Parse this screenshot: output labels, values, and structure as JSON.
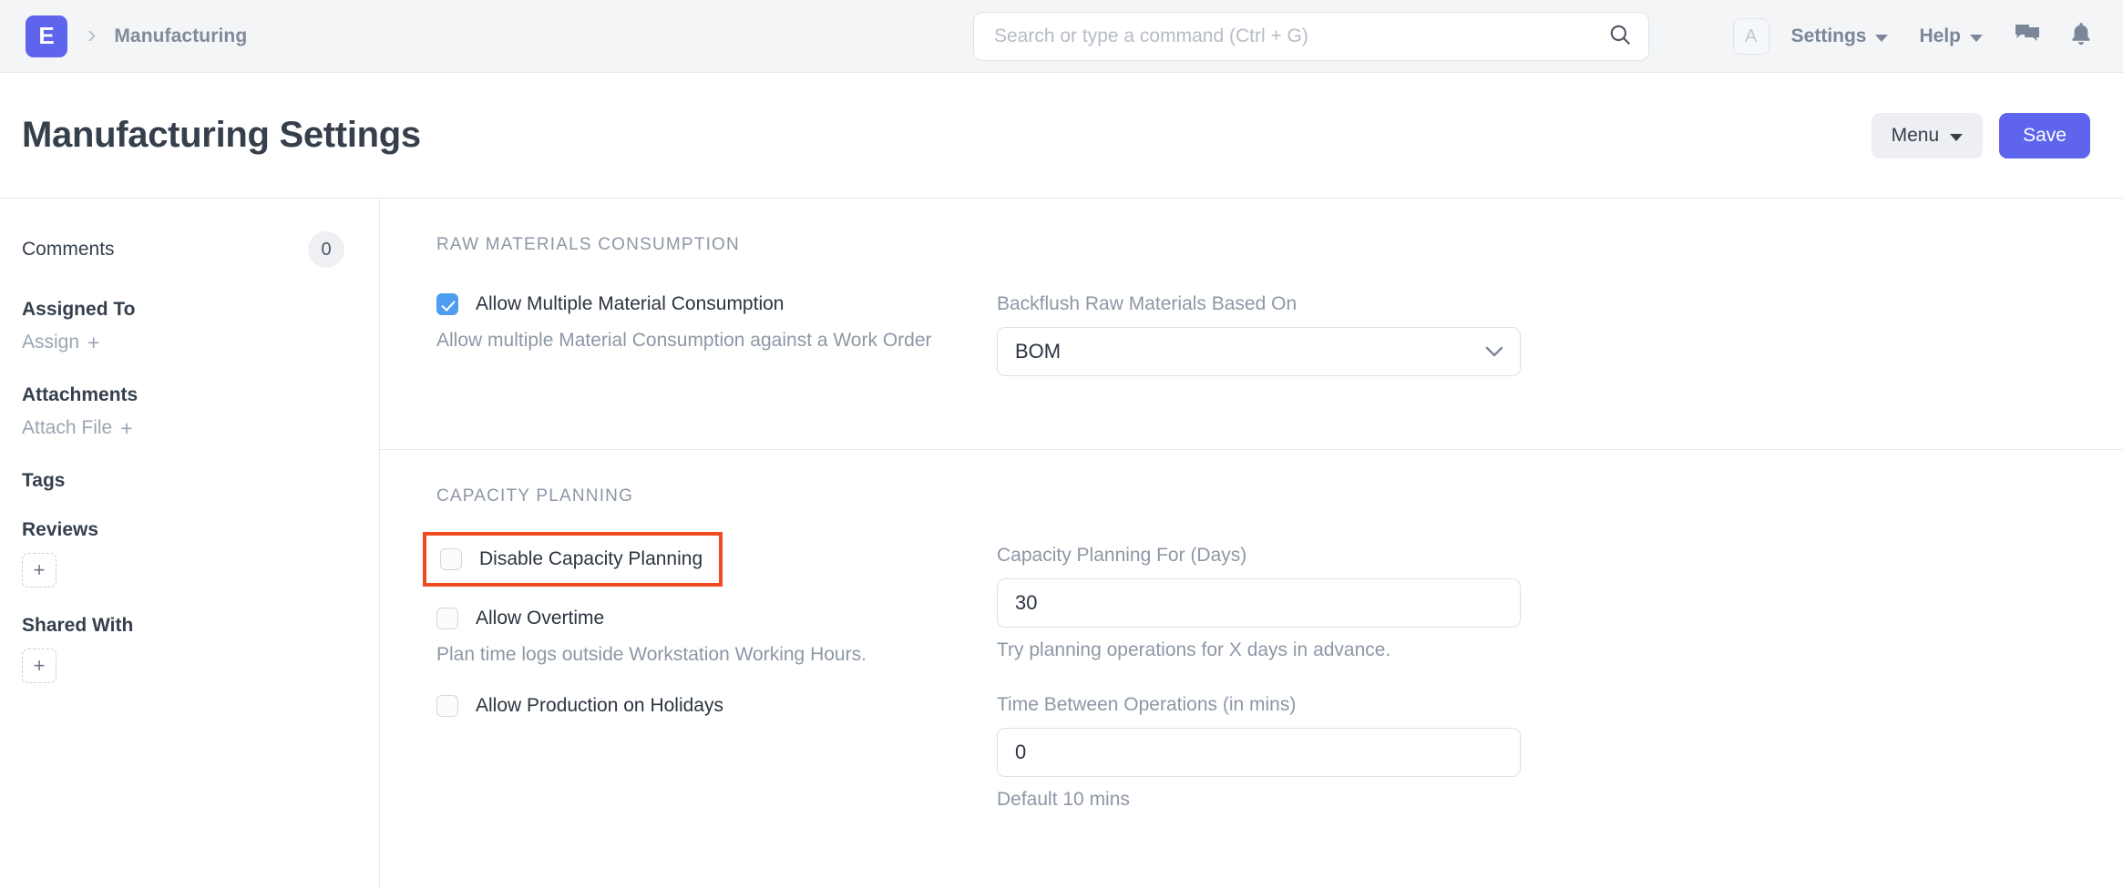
{
  "navbar": {
    "logo_letter": "E",
    "breadcrumb": "Manufacturing",
    "search_placeholder": "Search or type a command (Ctrl + G)",
    "search_value": "",
    "avatar_letter": "A",
    "settings_label": "Settings",
    "help_label": "Help"
  },
  "page_header": {
    "title": "Manufacturing Settings",
    "menu_label": "Menu",
    "save_label": "Save",
    "save_color": "#5e64ec"
  },
  "sidebar": {
    "comments_label": "Comments",
    "comments_count": "0",
    "assigned_to_label": "Assigned To",
    "assign_action": "Assign",
    "assign_plus": "+",
    "attachments_label": "Attachments",
    "attach_action": "Attach File",
    "attach_plus": "+",
    "tags_label": "Tags",
    "reviews_label": "Reviews",
    "reviews_add": "+",
    "shared_with_label": "Shared With",
    "shared_with_add": "+"
  },
  "sections": [
    {
      "title": "RAW MATERIALS CONSUMPTION",
      "checkbox_label": "Allow Multiple Material Consumption",
      "checkbox_help": "Allow multiple Material Consumption against a Work Order",
      "field_label": "Backflush Raw Materials Based On",
      "field_value": "BOM"
    },
    {
      "title": "CAPACITY PLANNING",
      "highlight_color": "#f04a23",
      "checkbox1_label": "Disable Capacity Planning",
      "checkbox2_label": "Allow Overtime",
      "checkbox2_help": "Plan time logs outside Workstation Working Hours.",
      "checkbox3_label": "Allow Production on Holidays",
      "field1_label": "Capacity Planning For (Days)",
      "field1_value": "30",
      "field1_help": "Try planning operations for X days in advance.",
      "field2_label": "Time Between Operations (in mins)",
      "field2_value": "0",
      "field2_help": "Default 10 mins"
    }
  ]
}
